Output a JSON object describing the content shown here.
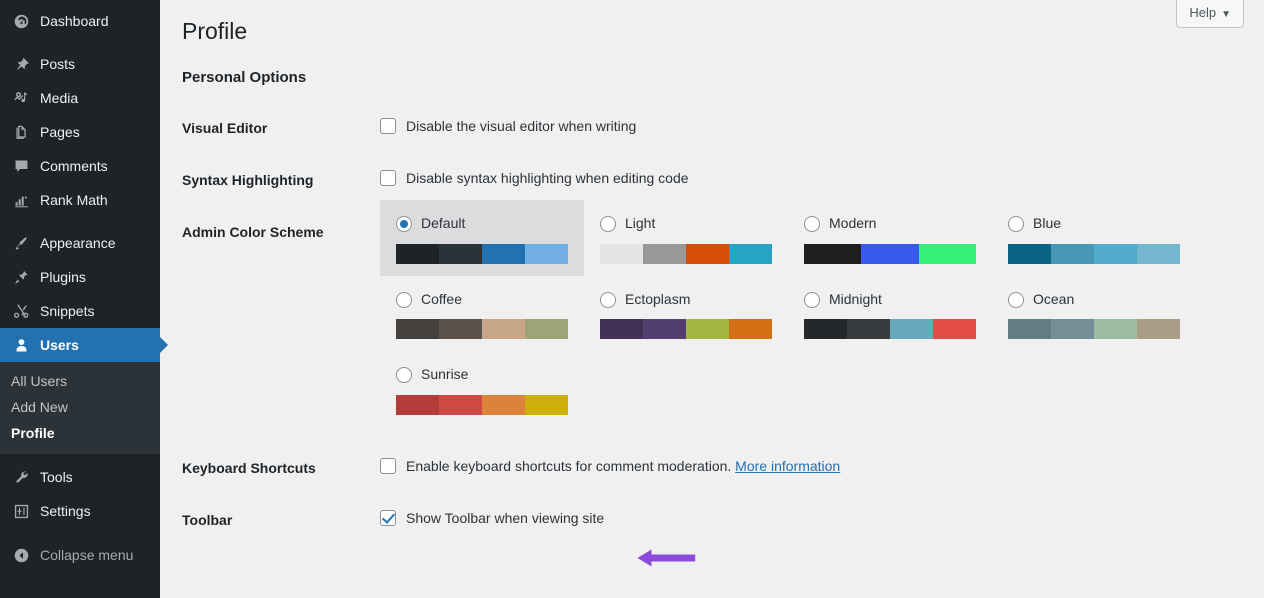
{
  "sidebar": {
    "items": [
      {
        "label": "Dashboard",
        "icon": "dashboard-icon",
        "state": "normal"
      },
      {
        "label": "Posts",
        "icon": "pin-icon",
        "state": "normal"
      },
      {
        "label": "Media",
        "icon": "media-icon",
        "state": "normal"
      },
      {
        "label": "Pages",
        "icon": "pages-icon",
        "state": "normal"
      },
      {
        "label": "Comments",
        "icon": "comment-icon",
        "state": "normal"
      },
      {
        "label": "Rank Math",
        "icon": "chart-bar-icon",
        "state": "normal"
      },
      {
        "label": "Appearance",
        "icon": "brush-icon",
        "state": "normal"
      },
      {
        "label": "Plugins",
        "icon": "plug-icon",
        "state": "normal"
      },
      {
        "label": "Snippets",
        "icon": "scissors-icon",
        "state": "normal"
      },
      {
        "label": "Users",
        "icon": "user-icon",
        "state": "current"
      },
      {
        "label": "Tools",
        "icon": "wrench-icon",
        "state": "normal"
      },
      {
        "label": "Settings",
        "icon": "sliders-icon",
        "state": "normal"
      },
      {
        "label": "Collapse menu",
        "icon": "collapse-arrow-icon",
        "state": "dim"
      }
    ],
    "submenu": [
      {
        "label": "All Users",
        "current": false
      },
      {
        "label": "Add New",
        "current": false
      },
      {
        "label": "Profile",
        "current": true
      }
    ]
  },
  "header": {
    "title": "Profile",
    "help_label": "Help",
    "help_caret": "▼"
  },
  "main": {
    "section_title": "Personal Options",
    "rows": {
      "visual_editor": {
        "label": "Visual Editor",
        "checkbox_label": "Disable the visual editor when writing",
        "checked": false
      },
      "syntax_highlighting": {
        "label": "Syntax Highlighting",
        "checkbox_label": "Disable syntax highlighting when editing code",
        "checked": false
      },
      "admin_color_scheme": {
        "label": "Admin Color Scheme"
      },
      "keyboard_shortcuts": {
        "label": "Keyboard Shortcuts",
        "checkbox_label": "Enable keyboard shortcuts for comment moderation.",
        "more_link": "More information",
        "checked": false
      },
      "toolbar": {
        "label": "Toolbar",
        "checkbox_label": "Show Toolbar when viewing site",
        "checked": true
      }
    },
    "color_schemes": [
      {
        "name": "Default",
        "selected": true,
        "colors": [
          "#1d2327",
          "#2c3338",
          "#2271b1",
          "#72aee6"
        ]
      },
      {
        "name": "Light",
        "selected": false,
        "colors": [
          "#e5e5e5",
          "#999999",
          "#d64e07",
          "#27a3c6"
        ]
      },
      {
        "name": "Modern",
        "selected": false,
        "colors": [
          "#1e1e1e",
          "#3858e9",
          "#33f078"
        ]
      },
      {
        "name": "Blue",
        "selected": false,
        "colors": [
          "#096484",
          "#4796b3",
          "#52accc",
          "#74b6ce"
        ]
      },
      {
        "name": "Coffee",
        "selected": false,
        "colors": [
          "#46403c",
          "#59524c",
          "#c7a589",
          "#9ea476"
        ]
      },
      {
        "name": "Ectoplasm",
        "selected": false,
        "colors": [
          "#413256",
          "#523f6d",
          "#a3b745",
          "#d46f15"
        ]
      },
      {
        "name": "Midnight",
        "selected": false,
        "colors": [
          "#25282b",
          "#363b3f",
          "#69a8bb",
          "#e14d43"
        ]
      },
      {
        "name": "Ocean",
        "selected": false,
        "colors": [
          "#627c83",
          "#738e96",
          "#9ebaa0",
          "#aa9d88"
        ]
      },
      {
        "name": "Sunrise",
        "selected": false,
        "colors": [
          "#b43c38",
          "#cf4944",
          "#dd823b",
          "#ccaf0b"
        ]
      }
    ]
  },
  "annotations": {
    "arrow_color": "#8c4bd8",
    "arrows": [
      {
        "name": "profile-arrow",
        "points": "left"
      },
      {
        "name": "toolbar-arrow",
        "points": "left"
      }
    ]
  }
}
